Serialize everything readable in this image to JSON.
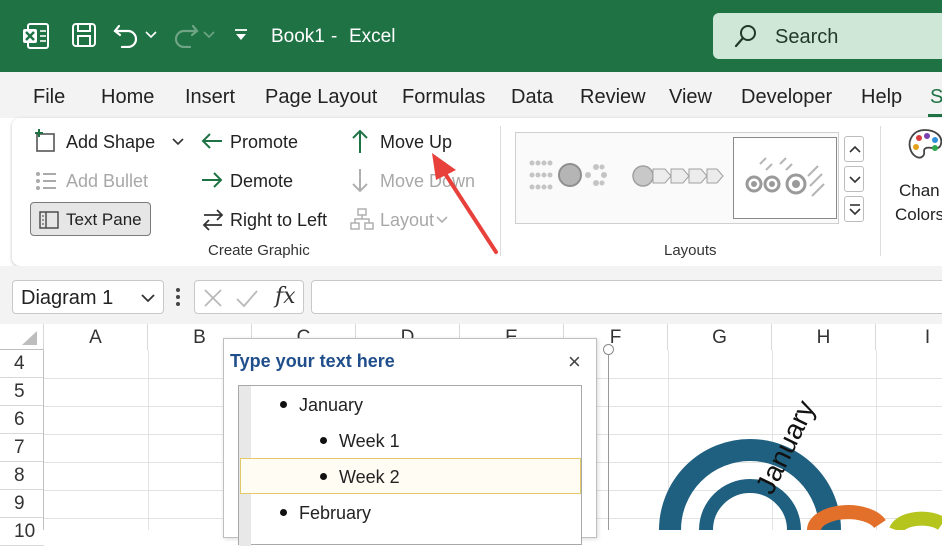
{
  "titlebar": {
    "doc_title": "Book1",
    "separator": "-",
    "app_name": "Excel",
    "search_label": "Search",
    "bg_color": "#1f7244"
  },
  "tabs": [
    "File",
    "Home",
    "Insert",
    "Page Layout",
    "Formulas",
    "Data",
    "Review",
    "View",
    "Developer",
    "Help",
    "S"
  ],
  "ribbon": {
    "create_graphic": {
      "add_shape": "Add Shape",
      "add_bullet": "Add Bullet",
      "text_pane": "Text Pane",
      "promote": "Promote",
      "demote": "Demote",
      "right_to_left": "Right to Left",
      "move_up": "Move Up",
      "move_down": "Move Down",
      "layout": "Layout",
      "group_label": "Create Graphic"
    },
    "layouts": {
      "group_label": "Layouts"
    },
    "change_colors": {
      "line1": "Chan",
      "line2": "Colors"
    }
  },
  "formula_bar": {
    "name_box": "Diagram 1",
    "fx_label": "fx",
    "formula": ""
  },
  "grid": {
    "columns": [
      "A",
      "B",
      "C",
      "D",
      "E",
      "F",
      "G",
      "H",
      "I"
    ],
    "rows": [
      "4",
      "5",
      "6",
      "7",
      "8",
      "9",
      "10"
    ]
  },
  "text_pane": {
    "title": "Type your text here",
    "close": "×",
    "items": [
      {
        "text": "January",
        "level": 1
      },
      {
        "text": "Week 1",
        "level": 2
      },
      {
        "text": "Week 2",
        "level": 2,
        "selected": true
      },
      {
        "text": "February",
        "level": 1
      }
    ]
  },
  "diagram": {
    "label": "January",
    "primary_color": "#1f5f80",
    "accent_colors": [
      "#e2702b",
      "#b6c41e"
    ]
  },
  "annotation": {
    "arrow_color": "#e8413b"
  }
}
